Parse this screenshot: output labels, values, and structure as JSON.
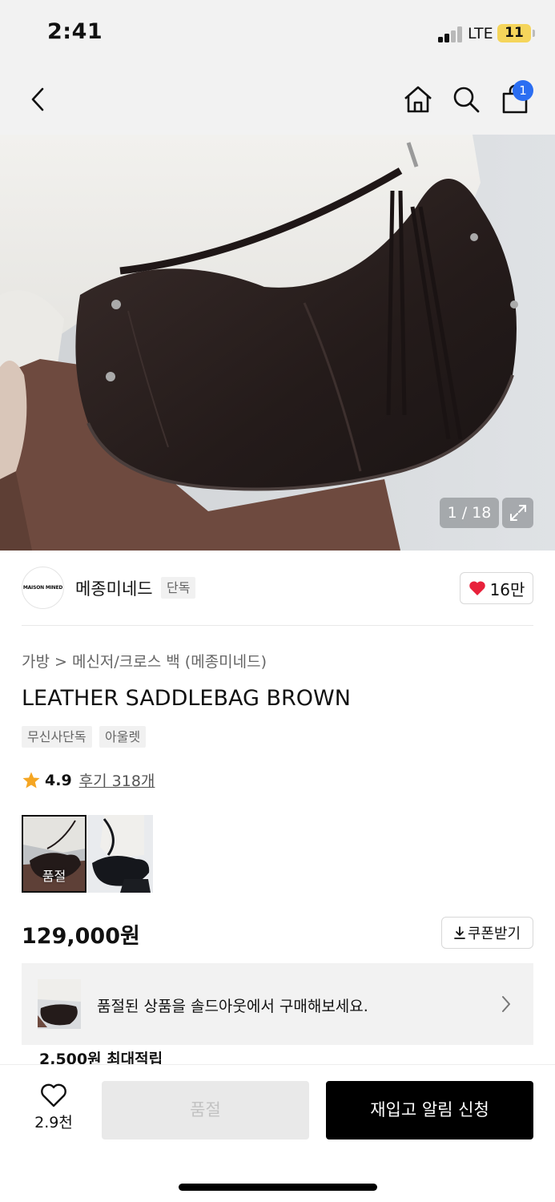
{
  "status_bar": {
    "time": "2:41",
    "network": "LTE",
    "battery": "11"
  },
  "nav": {
    "cart_count": "1",
    "icons": [
      "back-arrow-icon",
      "home-icon",
      "search-icon",
      "shopping-bag-icon"
    ]
  },
  "gallery": {
    "counter": "1 / 18"
  },
  "brand": {
    "logo_text": "MAISON MINED",
    "name": "메종미네드",
    "exclusive_tag": "단독",
    "likes": "16만"
  },
  "breadcrumb": "가방 > 메신저/크로스 백 (메종미네드)",
  "product": {
    "title": "LEATHER SADDLEBAG BROWN",
    "tags": [
      "무신사단독",
      "아울렛"
    ],
    "rating": "4.9",
    "reviews": "후기 318개",
    "swatch_soldout": "품절",
    "price": "129,000원",
    "coupon_label": "쿠폰받기"
  },
  "soldout_banner": {
    "text": "품절된 상품을 솔드아웃에서 구매해보세요."
  },
  "points": {
    "text": "2,500원 최대적립"
  },
  "bottom_bar": {
    "wish_count": "2.9천",
    "soldout_label": "품절",
    "restock_label": "재입고 알림 신청"
  },
  "colors": {
    "accent_blue": "#2b6ef2",
    "like_red": "#e8213b",
    "star": "#f5a623",
    "bag_leather": "#2a1f1e",
    "button_black": "#000000"
  }
}
